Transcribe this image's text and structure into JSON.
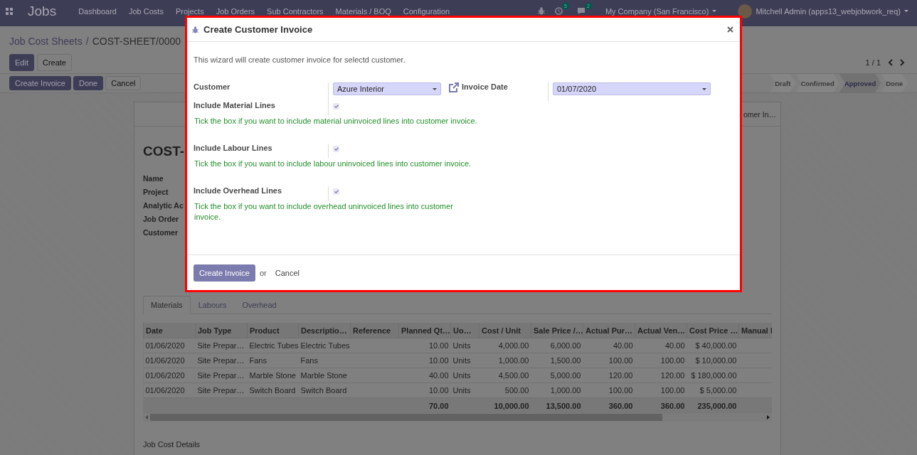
{
  "navbar": {
    "app_title": "Jobs",
    "menu": [
      "Dashboard",
      "Job Costs",
      "Projects",
      "Job Orders",
      "Sub Contractors",
      "Materials / BOQ",
      "Configuration"
    ],
    "activity_count": "5",
    "message_count": "2",
    "company": "My Company (San Francisco)",
    "user": "Mitchell Admin (apps13_webjobwork_req)"
  },
  "breadcrumb": {
    "parent": "Job Cost Sheets",
    "separator": "/",
    "current": "COST-SHEET/0000"
  },
  "control_buttons": [
    {
      "label": "Edit",
      "kind": "primary"
    },
    {
      "label": "Create",
      "kind": "secondary"
    }
  ],
  "pager": "1 / 1",
  "header_buttons": [
    {
      "label": "Create Invoice",
      "kind": "primary"
    },
    {
      "label": "Done",
      "kind": "primary"
    },
    {
      "label": "Cancel",
      "kind": "secondary"
    }
  ],
  "statusbar": [
    {
      "label": "Draft",
      "selected": false
    },
    {
      "label": "Confirmed",
      "selected": false
    },
    {
      "label": "Approved",
      "selected": true
    },
    {
      "label": "Done",
      "selected": false
    }
  ],
  "sheet": {
    "smart_button": "omer In…",
    "title": "COST-",
    "field_labels": [
      "Name",
      "Project",
      "Analytic Ac",
      "Job Order",
      "Customer"
    ],
    "tabs": [
      {
        "label": "Materials",
        "selected": true
      },
      {
        "label": "Labours",
        "selected": false
      },
      {
        "label": "Overhead",
        "selected": false
      }
    ],
    "table": {
      "columns": [
        {
          "label": "Date",
          "kind": "text"
        },
        {
          "label": "Job Type",
          "kind": "text"
        },
        {
          "label": "Product",
          "kind": "text"
        },
        {
          "label": "Descriptio…",
          "kind": "text"
        },
        {
          "label": "Reference",
          "kind": "text"
        },
        {
          "label": "Planned Qt…",
          "kind": "number",
          "total": "70.00"
        },
        {
          "label": "Uo…",
          "kind": "text"
        },
        {
          "label": "Cost / Unit",
          "kind": "number",
          "total": "10,000.00"
        },
        {
          "label": "Sale Price /…",
          "kind": "number",
          "total": "13,500.00"
        },
        {
          "label": "Actual Pur…",
          "kind": "number",
          "total": "360.00"
        },
        {
          "label": "Actual Ven…",
          "kind": "number",
          "total": "360.00"
        },
        {
          "label": "Cost Price …",
          "kind": "number",
          "total": "235,000.00"
        },
        {
          "label": "Manual I",
          "kind": "text"
        }
      ],
      "rows": [
        [
          "01/06/2020",
          "Site Prepar…",
          "Electric Tubes",
          "Electric Tubes",
          null,
          "10.00",
          "Units",
          "4,000.00",
          "6,000.00",
          "40.00",
          "40.00",
          "$ 40,000.00",
          null
        ],
        [
          "01/06/2020",
          "Site Prepar…",
          "Fans",
          "Fans",
          null,
          "10.00",
          "Units",
          "1,000.00",
          "1,500.00",
          "100.00",
          "100.00",
          "$ 10,000.00",
          null
        ],
        [
          "01/06/2020",
          "Site Prepar…",
          "Marble Stone",
          "Marble Stone",
          null,
          "40.00",
          "Units",
          "4,500.00",
          "5,000.00",
          "120.00",
          "120.00",
          "$ 180,000.00",
          null
        ],
        [
          "01/06/2020",
          "Site Prepar…",
          "Switch Board",
          "Switch Board",
          null,
          "10.00",
          "Units",
          "500.00",
          "1,000.00",
          "100.00",
          "100.00",
          "$ 5,000.00",
          null
        ]
      ]
    },
    "footer_link": "Job Cost Details"
  },
  "dialog": {
    "title": "Create Customer Invoice",
    "intro": "This wizard will create customer invoice for selectd customer.",
    "customer": {
      "label": "Customer",
      "value": "Azure Interior"
    },
    "invoice_date": {
      "label": "Invoice Date",
      "value": "01/07/2020"
    },
    "options": [
      {
        "label": "Include Material Lines",
        "checked": true,
        "help": "Tick the box if you want to include material uninvoiced lines into customer invoice."
      },
      {
        "label": "Include Labour Lines",
        "checked": true,
        "help": "Tick the box if you want to include labour uninvoiced lines into customer invoice."
      },
      {
        "label": "Include Overhead Lines",
        "checked": true,
        "help": "Tick the box if you want to include overhead uninvoiced lines into customer invoice."
      }
    ],
    "primary_button": "Create Invoice",
    "or_text": "or",
    "cancel_button": "Cancel"
  }
}
